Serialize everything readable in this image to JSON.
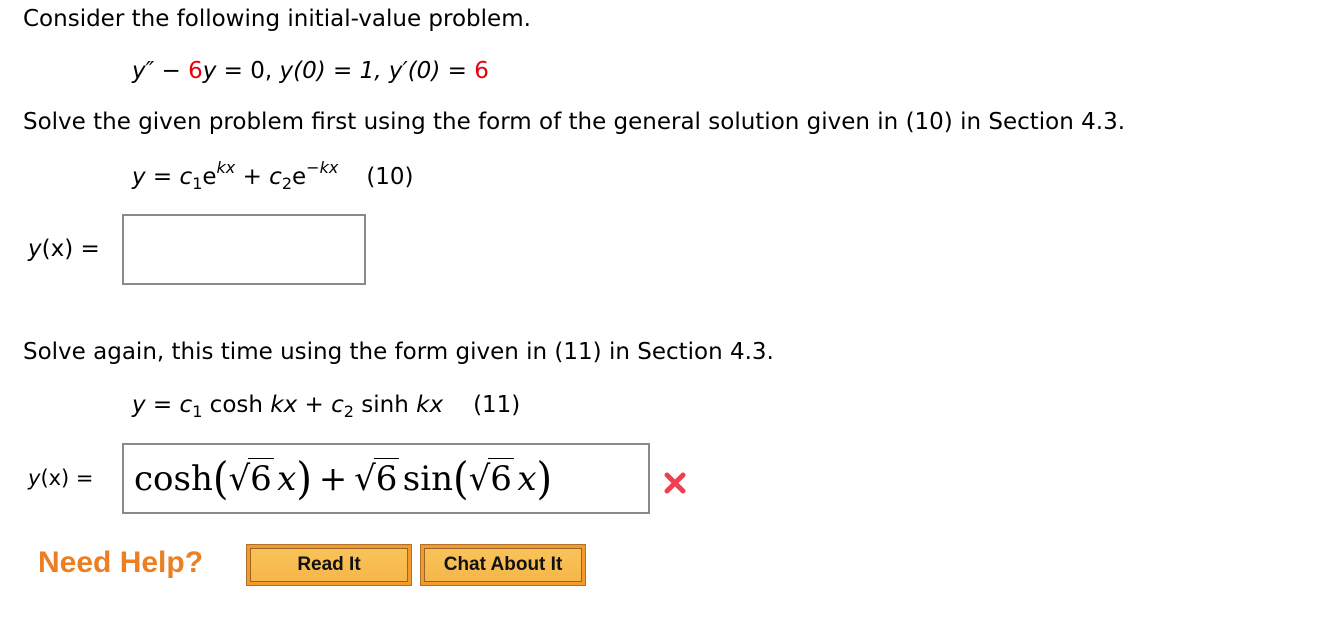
{
  "intro": "Consider the following initial-value problem.",
  "ode": {
    "y2": "y″",
    "minus": " − ",
    "coef": "6",
    "y": "y",
    "eq_zero": " = 0,  ",
    "ic1": "y(0) = 1, ",
    "ic2_lhs": "y′(0) = ",
    "ic2_val": "6"
  },
  "part1": {
    "instruction": "Solve the given problem first using the form of the general solution given in (10) in Section 4.3.",
    "formula": {
      "lhs": "y",
      "eq": " = ",
      "c1": "c",
      "c1_sub": "1",
      "e1": "e",
      "exp1": "kx",
      "plus": " + ",
      "c2": "c",
      "c2_sub": "2",
      "e2": "e",
      "exp2": "−kx",
      "label": "(10)"
    },
    "answer_label_y": "y",
    "answer_label_rest": "(x) =",
    "answer_value": ""
  },
  "part2": {
    "instruction": "Solve again, this time using the form given in (11) in Section 4.3.",
    "formula": {
      "lhs": "y",
      "eq": " = ",
      "c1": "c",
      "c1_sub": "1",
      "cosh": " cosh ",
      "kx1": "kx",
      "plus": " + ",
      "c2": "c",
      "c2_sub": "2",
      "sinh": " sinh ",
      "kx2": "kx",
      "label": "(11)"
    },
    "answer_label_y": "y",
    "answer_label_rest": "(x) =",
    "answer": {
      "cosh": "cosh",
      "lparen": "(",
      "rparen": ")",
      "radical": "√",
      "six": "6",
      "x": "x",
      "plus": "+",
      "sin": "sin"
    },
    "status": "incorrect"
  },
  "help": {
    "label": "Need Help?",
    "buttons": [
      "Read It",
      "Chat About It"
    ]
  },
  "colors": {
    "highlight": "#e8000d",
    "help_text": "#ec7f21",
    "button_fill": "#f6b64a",
    "incorrect_mark": "#f04050"
  }
}
